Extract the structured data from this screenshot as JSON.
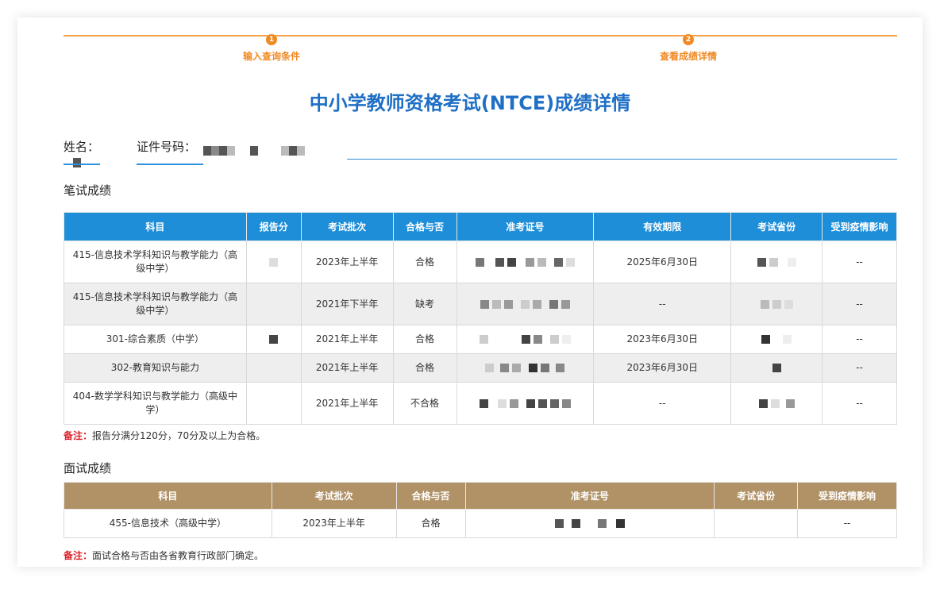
{
  "steps": [
    {
      "num": "1",
      "label": "输入查询条件"
    },
    {
      "num": "2",
      "label": "查看成绩详情"
    }
  ],
  "title": "中小学教师资格考试(NTCE)成绩详情",
  "identity": {
    "name_label": "姓名：",
    "id_label": "证件号码："
  },
  "written": {
    "section_title": "笔试成绩",
    "headers": [
      "科目",
      "报告分",
      "考试批次",
      "合格与否",
      "准考证号",
      "有效期限",
      "考试省份",
      "受到疫情影响"
    ],
    "rows": [
      {
        "subject": "415-信息技术学科知识与教学能力（高级中学）",
        "batch": "2023年上半年",
        "result": "合格",
        "valid": "2025年6月30日",
        "covid": "--"
      },
      {
        "subject": "415-信息技术学科知识与教学能力（高级中学）",
        "batch": "2021年下半年",
        "result": "缺考",
        "valid": "--",
        "covid": "--"
      },
      {
        "subject": "301-综合素质（中学）",
        "batch": "2021年上半年",
        "result": "合格",
        "valid": "2023年6月30日",
        "covid": "--"
      },
      {
        "subject": "302-教育知识与能力",
        "batch": "2021年上半年",
        "result": "合格",
        "valid": "2023年6月30日",
        "covid": "--"
      },
      {
        "subject": "404-数学学科知识与教学能力（高级中学）",
        "batch": "2021年上半年",
        "result": "不合格",
        "valid": "--",
        "covid": "--"
      }
    ],
    "note_label": "备注：",
    "note_text": "报告分满分120分，70分及以上为合格。"
  },
  "interview": {
    "section_title": "面试成绩",
    "headers": [
      "科目",
      "考试批次",
      "合格与否",
      "准考证号",
      "考试省份",
      "受到疫情影响"
    ],
    "rows": [
      {
        "subject": "455-信息技术（高级中学）",
        "batch": "2023年上半年",
        "result": "合格",
        "covid": "--"
      }
    ],
    "note_label": "备注：",
    "note_text": "面试合格与否由各省教育行政部门确定。"
  },
  "colors": {
    "accent_orange": "#f08a24",
    "title_blue": "#1f6fc5",
    "header_blue": "#1e8ed9",
    "header_brown": "#b19266",
    "note_red": "#d9232b"
  }
}
